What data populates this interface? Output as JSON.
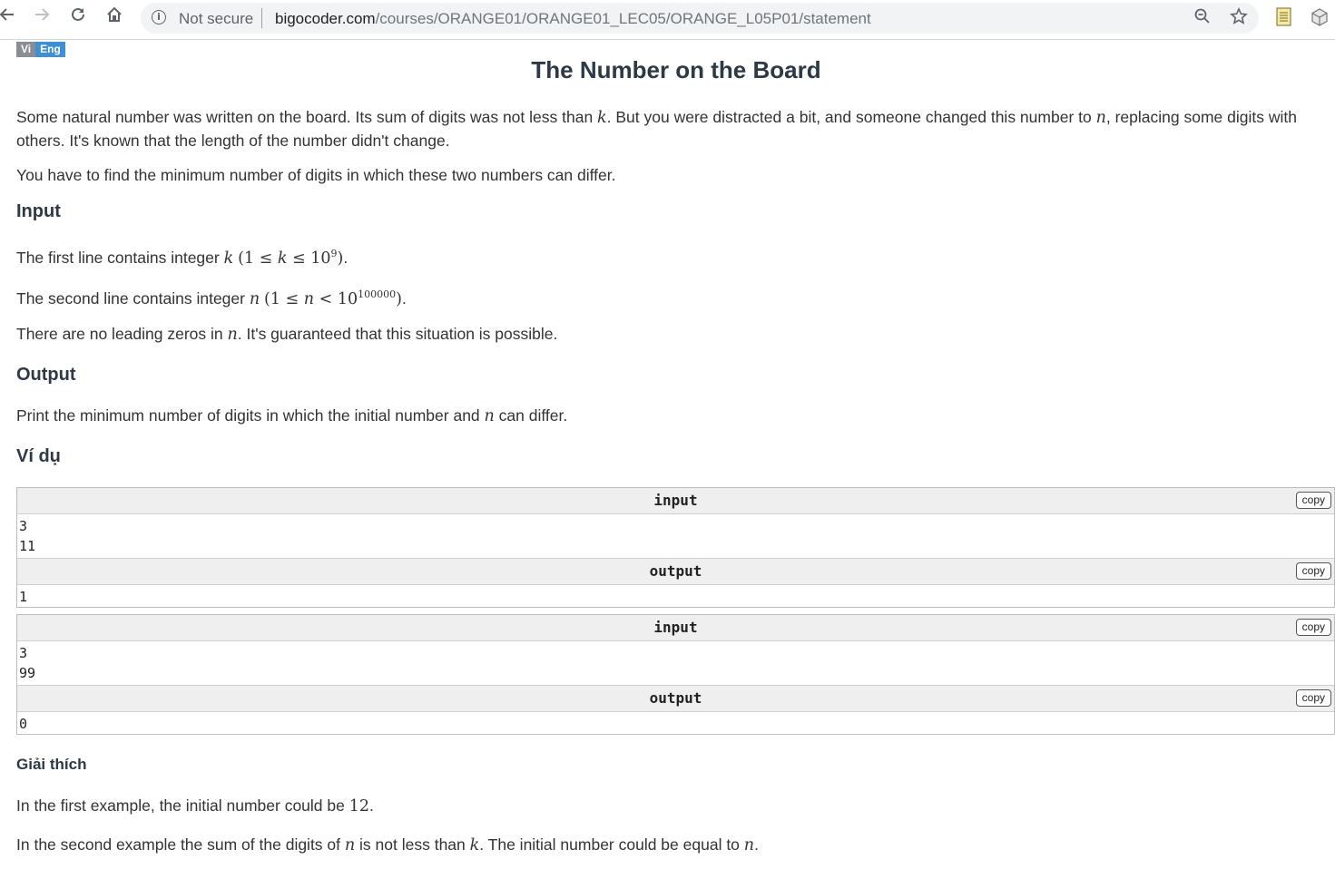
{
  "browser": {
    "security_label": "Not secure",
    "url_host": "bigocoder.com",
    "url_path": "/courses/ORANGE01/ORANGE01_LEC05/ORANGE_L05P01/statement",
    "icons": [
      "back-icon",
      "forward-icon",
      "reload-icon",
      "home-icon",
      "info-icon",
      "zoom-icon",
      "star-icon",
      "notes-extension-icon",
      "cube-extension-icon"
    ]
  },
  "lang": {
    "vi": "Vi",
    "eng": "Eng"
  },
  "problem": {
    "title": "The Number on the Board",
    "statement_1a": "Some natural number was written on the board. Its sum of digits was not less than ",
    "statement_1b": ". But you were distracted a bit, and someone changed this number to ",
    "statement_1c": ", replacing some digits with",
    "statement_1d": "others. It's known that the length of the number didn't change.",
    "statement_2": "You have to find the minimum number of digits in which these two numbers can differ.",
    "input_heading": "Input",
    "input_1": "The first line contains integer ",
    "input_1_bound": "10",
    "input_1_exp": "9",
    "input_2": "The second line contains integer ",
    "input_2_bound": "10",
    "input_2_exp": "100000",
    "input_3a": "There are no leading zeros in ",
    "input_3b": ". It's guaranteed that this situation is possible.",
    "output_heading": "Output",
    "output_1a": "Print the minimum number of digits in which the initial number and ",
    "output_1b": " can differ.",
    "examples_heading": "Ví dụ",
    "note_heading": "Giải thích",
    "note_1a": "In the first example, the initial number could be ",
    "note_1_value": "12",
    "note_2a": "In the second example the sum of the digits of ",
    "note_2b": " is not less than ",
    "note_2c": ". The initial number could be equal to ",
    "var_k": "k",
    "var_n": "n",
    "one": "1"
  },
  "samples": [
    {
      "input_label": "input",
      "input": "3\n11",
      "output_label": "output",
      "output": "1",
      "copy_label": "copy"
    },
    {
      "input_label": "input",
      "input": "3\n99",
      "output_label": "output",
      "output": "0",
      "copy_label": "copy"
    }
  ],
  "colors": {
    "eng_badge": "#3d8fd6",
    "vi_badge": "#888e94",
    "heading": "#2d3a45"
  }
}
